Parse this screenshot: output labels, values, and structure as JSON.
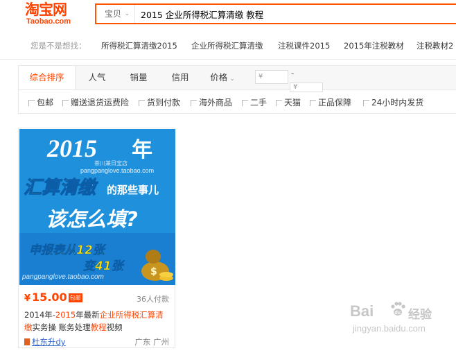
{
  "header": {
    "logo_cn": "淘宝网",
    "logo_en": "Taobao.com",
    "search_category": "宝贝",
    "search_value": "2015 企业所得税汇算清缴 教程"
  },
  "suggestions": {
    "label": "您是不是想找：",
    "items": [
      "所得税汇算清缴2015",
      "企业所得税汇算清缴",
      "注税课件2015",
      "2015年注税教材",
      "注税教材2"
    ]
  },
  "sortbar": {
    "tabs": [
      "综合排序",
      "人气",
      "销量",
      "信用",
      "价格"
    ],
    "price_min_placeholder": "¥",
    "price_max_placeholder": "¥",
    "dash": "-"
  },
  "filters": [
    "包邮",
    "赠送退货运费险",
    "货到付款",
    "海外商品",
    "二手",
    "天猫",
    "正品保障",
    "24小时内发货"
  ],
  "product": {
    "image_text": {
      "year": "2015",
      "nian": "年",
      "line1": "汇算清缴",
      "line1b": "的那些事儿",
      "line2": "该怎么填?",
      "line3": "申报表从12张",
      "line4": "变41张",
      "url1": "pangpanglove.taobao.com",
      "url2": "pangpanglove.taobao.com",
      "shop_wm": "茶川兼日宝店"
    },
    "price_symbol": "¥",
    "price": "15.00",
    "badge": "包邮",
    "paid_count": "36人付款",
    "title_parts": [
      "2014年-",
      "2015",
      "年最新",
      "企业所得税汇算清",
      "缴",
      "实务操 账务处理",
      "教程",
      "视频"
    ],
    "shop": "杜东升dy",
    "location": "广东 广州"
  },
  "watermark": {
    "brand": "Bai",
    "brand2": "du",
    "cn": "经验",
    "url": "jingyan.baidu.com"
  },
  "colors": {
    "accent": "#ff4400",
    "image_blue": "#1e90dc",
    "link": "#3366cc"
  }
}
